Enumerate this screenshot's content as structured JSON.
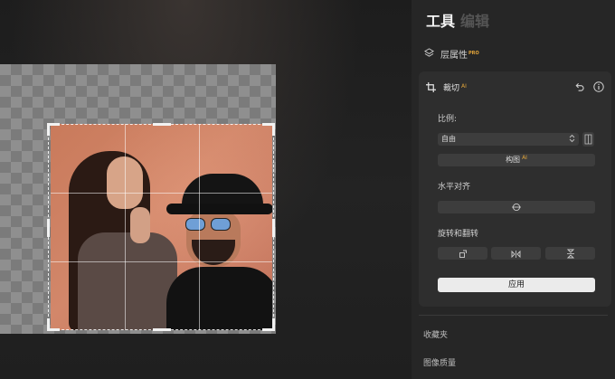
{
  "tabs": [
    {
      "label": "工具",
      "active": true
    },
    {
      "label": "编辑",
      "active": false
    }
  ],
  "layers": {
    "label": "层属性",
    "badge": "PRO",
    "icon": "layers-icon"
  },
  "crop": {
    "title": "裁切",
    "badge": "AI",
    "ratio_label": "比例:",
    "ratio_value": "自由",
    "compose_label": "构图",
    "compose_badge": "AI",
    "straighten_label": "水平对齐",
    "rotate_flip_label": "旋转和翻转",
    "apply_label": "应用"
  },
  "bottom_items": [
    "收藏夹",
    "图像质量"
  ],
  "colors": {
    "accent": "#e0a33a",
    "panel": "#262626",
    "card": "#2e2e2e"
  }
}
